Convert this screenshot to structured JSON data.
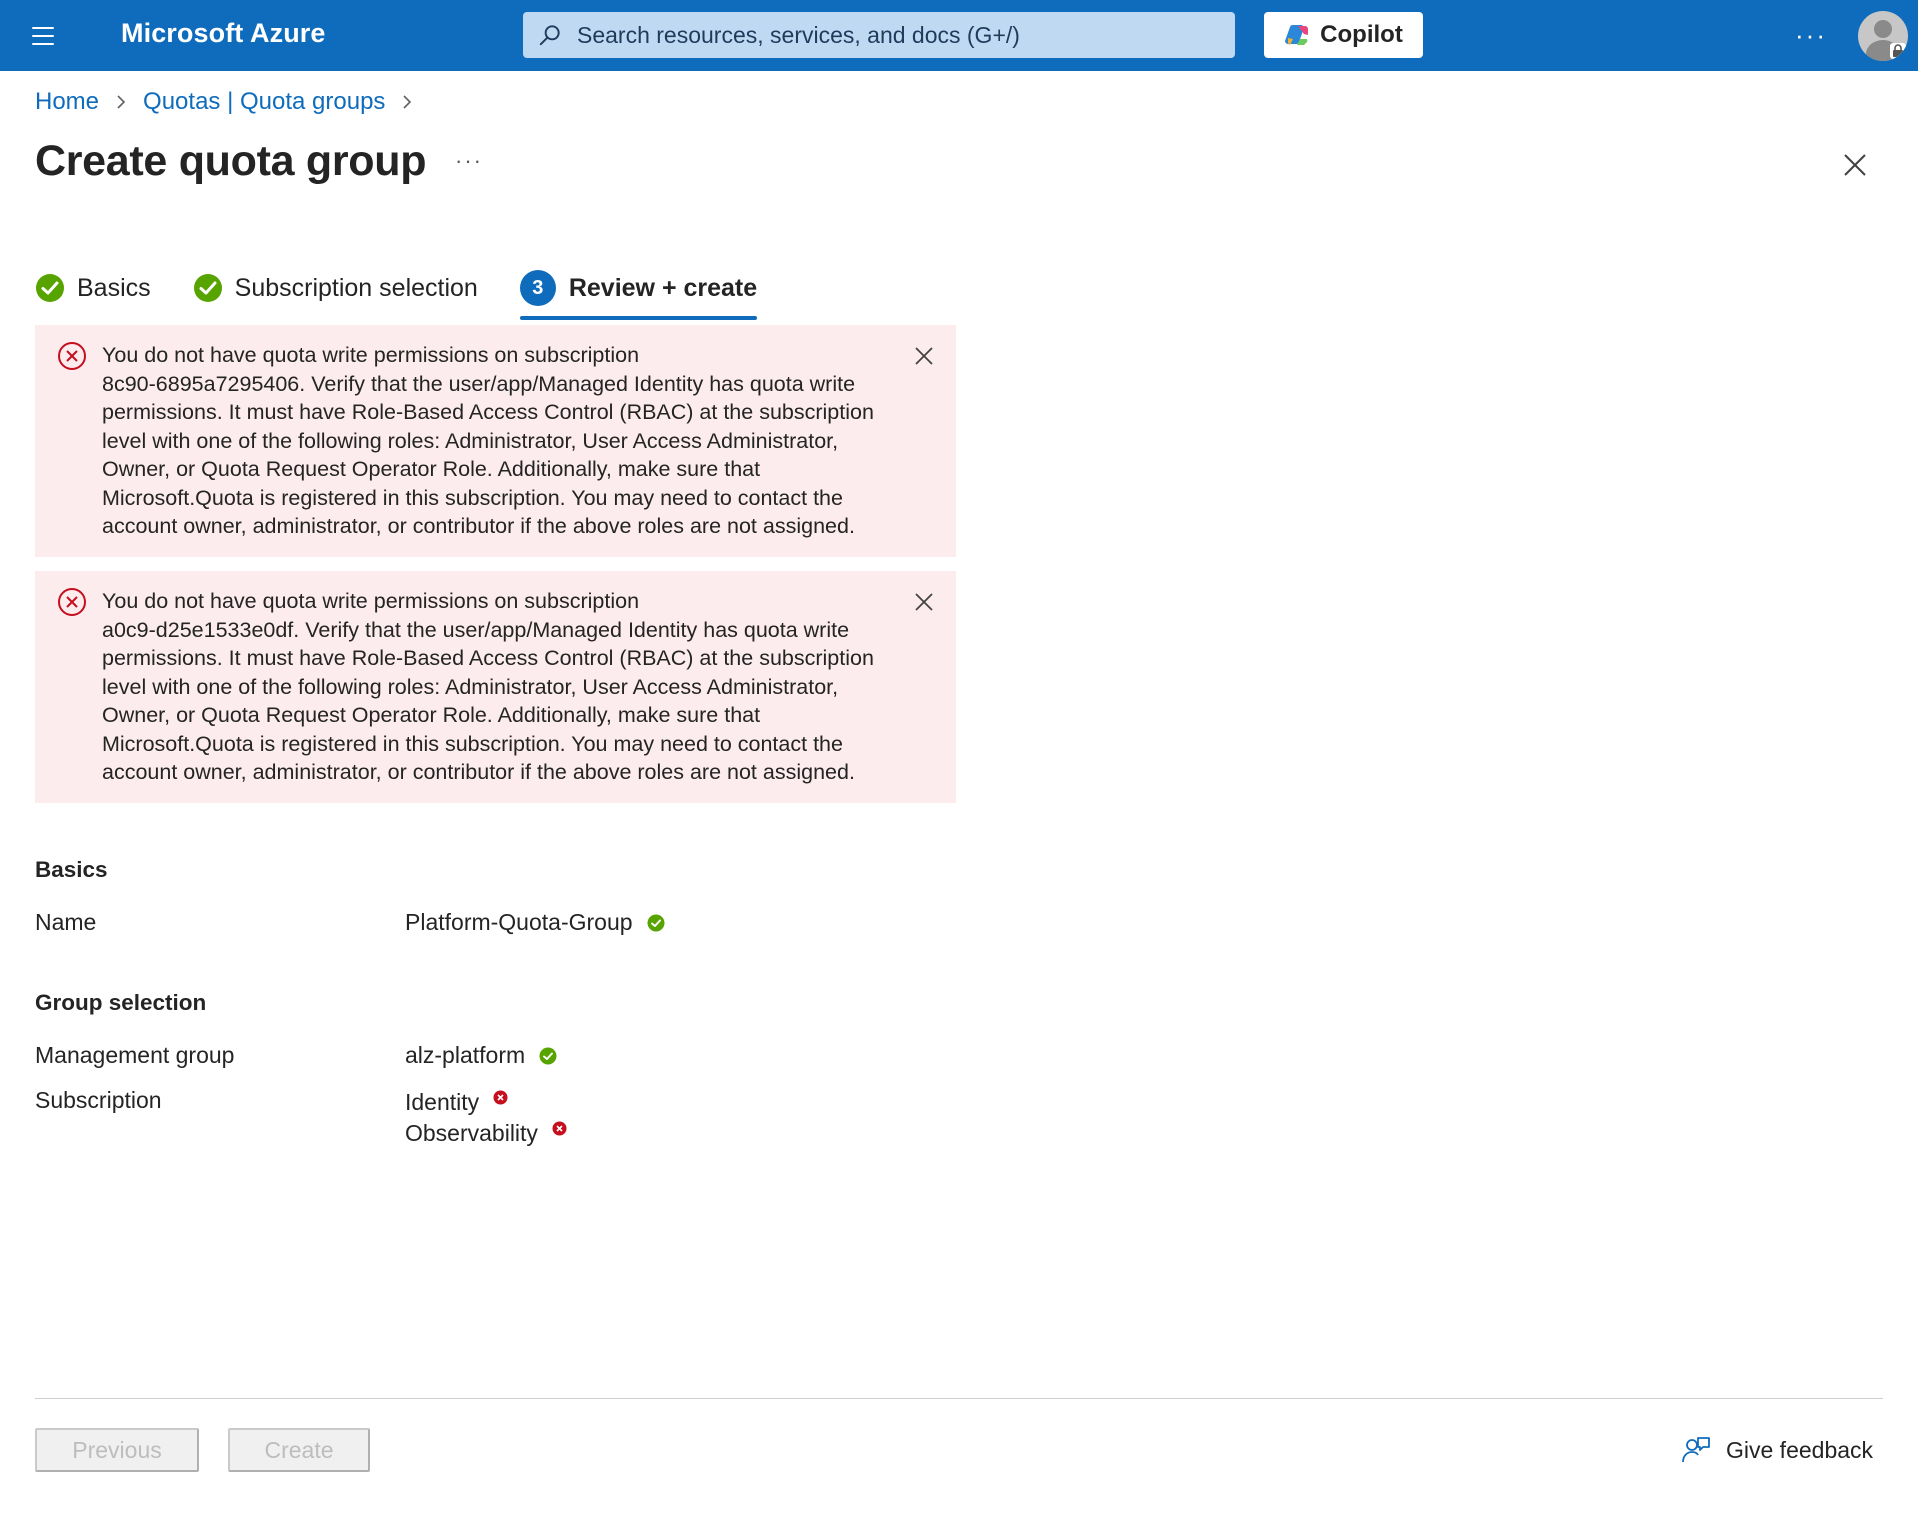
{
  "topbar": {
    "brand": "Microsoft Azure",
    "search_placeholder": "Search resources, services, and docs (G+/)",
    "copilot_label": "Copilot",
    "more_label": "···"
  },
  "breadcrumb": {
    "items": [
      "Home",
      "Quotas | Quota groups"
    ]
  },
  "page": {
    "title": "Create quota group",
    "more_label": "···"
  },
  "tabs": [
    {
      "label": "Basics",
      "status": "complete"
    },
    {
      "label": "Subscription selection",
      "status": "complete"
    },
    {
      "label": "Review + create",
      "number": "3",
      "status": "active"
    }
  ],
  "alerts": [
    {
      "lines": [
        "You do not have quota write permissions on subscription",
        "8c90-6895a7295406. Verify that the user/app/Managed Identity has quota write",
        "permissions. It must have Role-Based Access Control (RBAC) at the subscription",
        "level with one of the following roles: Administrator, User Access Administrator,",
        "Owner, or Quota Request Operator Role. Additionally, make sure that",
        "Microsoft.Quota is registered in this subscription. You may need to contact the",
        "account owner, administrator, or contributor if the above roles are not assigned."
      ]
    },
    {
      "lines": [
        "You do not have quota write permissions on subscription",
        "a0c9-d25e1533e0df. Verify that the user/app/Managed Identity has quota write",
        "permissions. It must have Role-Based Access Control (RBAC) at the subscription",
        "level with one of the following roles: Administrator, User Access Administrator,",
        "Owner, or Quota Request Operator Role. Additionally, make sure that",
        "Microsoft.Quota is registered in this subscription. You may need to contact the",
        "account owner, administrator, or contributor if the above roles are not assigned."
      ]
    }
  ],
  "review": {
    "basics": {
      "heading": "Basics",
      "name_label": "Name",
      "name_value": "Platform-Quota-Group"
    },
    "group_selection": {
      "heading": "Group selection",
      "management_group_label": "Management group",
      "management_group_value": "alz-platform",
      "subscription_label": "Subscription",
      "subscriptions": [
        "Identity",
        "Observability"
      ]
    }
  },
  "footer": {
    "previous_label": "Previous",
    "create_label": "Create",
    "feedback_label": "Give feedback"
  },
  "colors": {
    "accent": "#0f6cbd",
    "success": "#57a300",
    "error": "#c50f1f",
    "alert_bg": "#fdeced"
  }
}
